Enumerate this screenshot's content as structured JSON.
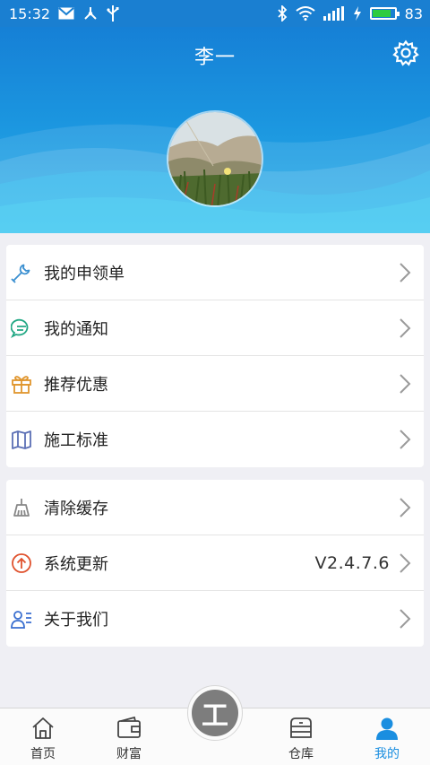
{
  "status_bar": {
    "time": "15:32",
    "battery_level": "83",
    "battery_fill": 0.83,
    "icons": [
      "mail-icon",
      "share-network-icon",
      "usb-icon",
      "bluetooth-icon",
      "wifi-icon",
      "signal-icon",
      "charging-icon",
      "battery-icon"
    ]
  },
  "header": {
    "title": "李一",
    "settings_icon": "gear-icon",
    "colors": {
      "top": "#1680d6",
      "bottom": "#2bb2ea"
    }
  },
  "menu_group_1": [
    {
      "label": "我的申领单",
      "icon": "wrench-icon",
      "icon_color": "#3a8fd0"
    },
    {
      "label": "我的通知",
      "icon": "chat-bubble-icon",
      "icon_color": "#22a884"
    },
    {
      "label": "推荐优惠",
      "icon": "gift-icon",
      "icon_color": "#e0962e"
    },
    {
      "label": "施工标准",
      "icon": "book-icon",
      "icon_color": "#5b6fb5"
    }
  ],
  "menu_group_2": [
    {
      "label": "清除缓存",
      "icon": "broom-icon",
      "icon_color": "#888888"
    },
    {
      "label": "系统更新",
      "value": "V2.4.7.6",
      "icon": "upload-arrow-icon",
      "icon_color": "#e0522e"
    },
    {
      "label": "关于我们",
      "icon": "contact-card-icon",
      "icon_color": "#3a6fd0"
    }
  ],
  "tabbar": {
    "tabs": [
      {
        "label": "首页",
        "icon": "home-icon",
        "active": false
      },
      {
        "label": "财富",
        "icon": "wallet-icon",
        "active": false
      },
      {
        "label": "仓库",
        "icon": "warehouse-icon",
        "active": false
      },
      {
        "label": "我的",
        "icon": "person-icon",
        "active": true
      }
    ],
    "center_label": "工",
    "active_color": "#1a8ee0"
  }
}
